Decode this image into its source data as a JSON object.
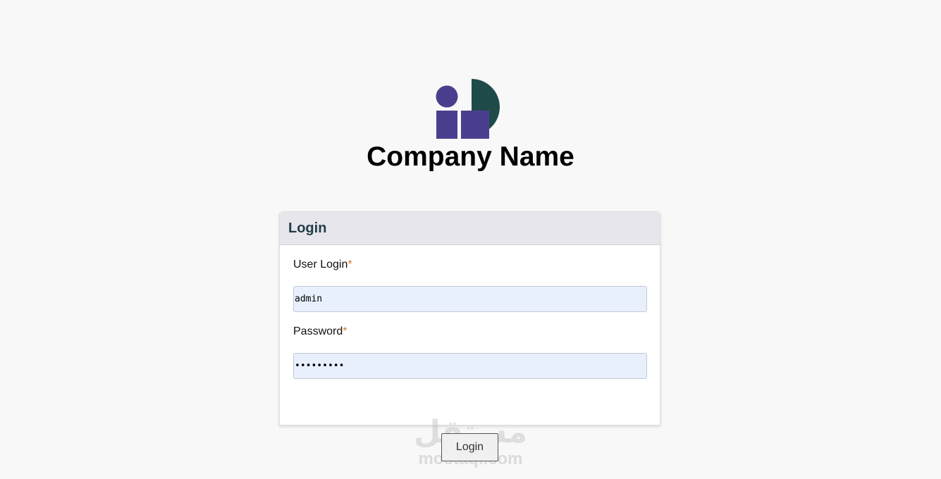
{
  "brand": {
    "company_name": "Company Name",
    "logo_colors": {
      "purple": "#4a3f8f",
      "teal": "#1f4a4a"
    }
  },
  "login_card": {
    "title": "Login",
    "user_login": {
      "label": "User Login",
      "required_mark": "*",
      "value": "admin"
    },
    "password": {
      "label": "Password",
      "required_mark": "*",
      "value": "•••••••••"
    }
  },
  "login_button": {
    "label": "Login"
  },
  "watermark": {
    "arabic": "مستقل",
    "latin": "mostaql.com"
  },
  "colors": {
    "header_bg": "#e7e6ec",
    "title_text": "#1f3d47",
    "input_bg": "#e8f0fe",
    "required": "#d97a2b"
  }
}
